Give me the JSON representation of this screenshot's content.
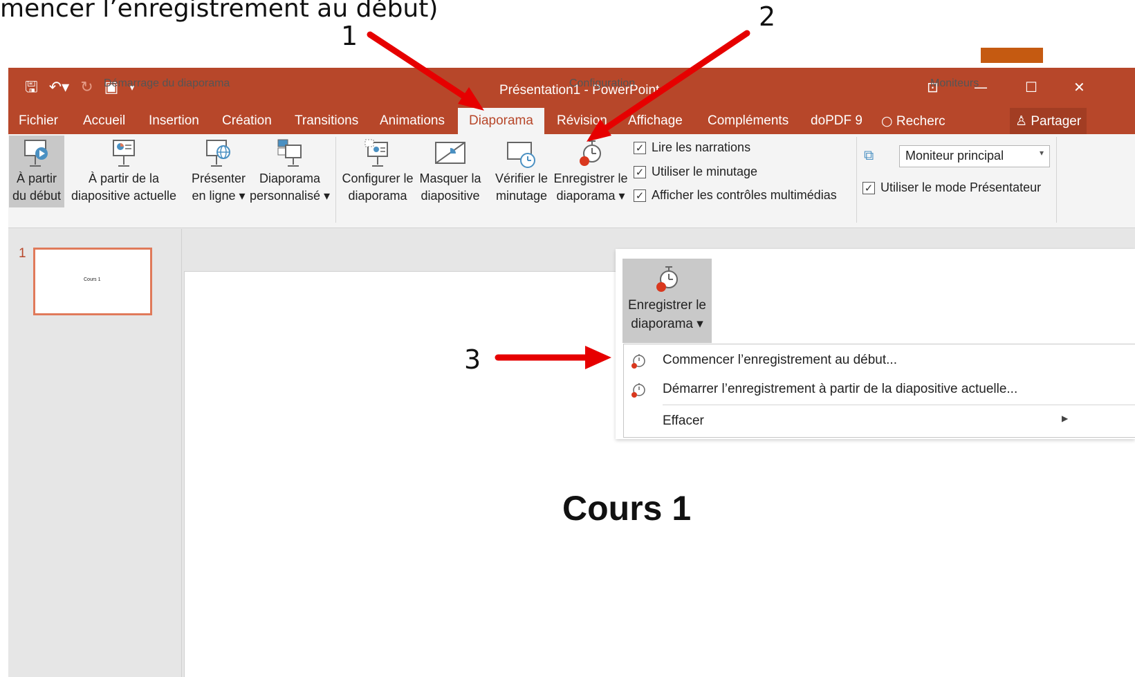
{
  "caption": "mencer l’enregistrement au début)",
  "callouts": [
    "1",
    "2",
    "3"
  ],
  "arrow_color": "#e60000",
  "window": {
    "title": "Présentation1 - PowerPoint",
    "accent": "#b7472a",
    "quick_access": [
      "save-icon",
      "undo-icon",
      "redo-icon",
      "start-slideshow-icon",
      "customize-qat-icon"
    ]
  },
  "tabs": [
    "Fichier",
    "Accueil",
    "Insertion",
    "Création",
    "Transitions",
    "Animations",
    "Diaporama",
    "Révision",
    "Affichage",
    "Compléments",
    "doPDF 9"
  ],
  "active_tab": "Diaporama",
  "search_label": "Recherc",
  "share_label": "Partager",
  "ribbon": {
    "groups": {
      "start": "Démarrage du diaporama",
      "config": "Configuration",
      "monitors": "Moniteurs"
    },
    "buttons": {
      "from_start": [
        "À partir",
        "du début"
      ],
      "from_current": [
        "À partir de la",
        "diapositive actuelle"
      ],
      "present_online": [
        "Présenter",
        "en ligne ▾"
      ],
      "custom_show": [
        "Diaporama",
        "personnalisé ▾"
      ],
      "setup": [
        "Configurer le",
        "diaporama"
      ],
      "hide_slide": [
        "Masquer la",
        "diapositive"
      ],
      "rehearse": [
        "Vérifier le",
        "minutage"
      ],
      "record": [
        "Enregistrer le",
        "diaporama ▾"
      ]
    },
    "checkboxes": [
      {
        "label": "Lire les narrations",
        "checked": true
      },
      {
        "label": "Utiliser le minutage",
        "checked": true
      },
      {
        "label": "Afficher les contrôles multimédias",
        "checked": true
      }
    ],
    "monitor_select": "Moniteur principal",
    "presenter_view": {
      "label": "Utiliser le mode Présentateur",
      "checked": true
    }
  },
  "slides_pane": {
    "number": "1",
    "thumb_text": "Cours 1"
  },
  "slide_title": "Cours 1",
  "record_menu": {
    "button": [
      "Enregistrer le",
      "diaporama ▾"
    ],
    "items": [
      "Commencer l’enregistrement au début...",
      "Démarrer l’enregistrement à partir de la diapositive actuelle...",
      "Effacer"
    ]
  }
}
